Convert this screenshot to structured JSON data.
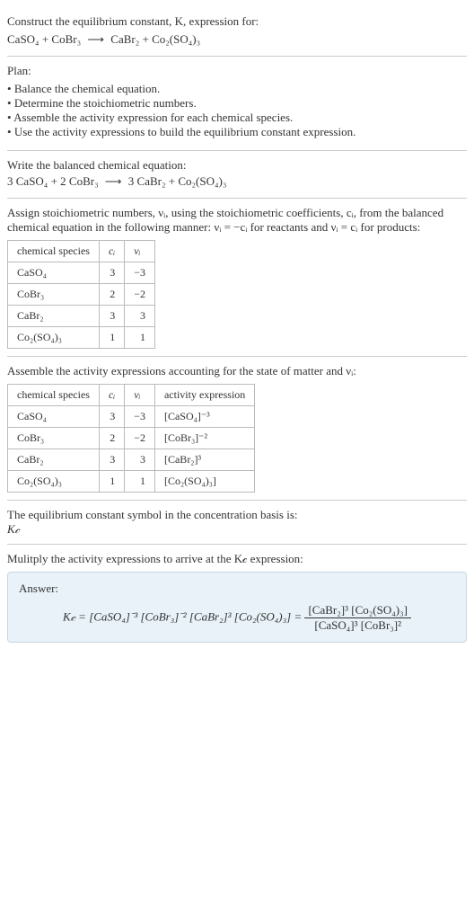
{
  "header": {
    "prompt": "Construct the equilibrium constant, K, expression for:",
    "equation_left": "CaSO₄ + CoBr₃",
    "equation_arrow": "⟶",
    "equation_right": "CaBr₂ + Co₂(SO₄)₃"
  },
  "plan": {
    "title": "Plan:",
    "items": [
      "Balance the chemical equation.",
      "Determine the stoichiometric numbers.",
      "Assemble the activity expression for each chemical species.",
      "Use the activity expressions to build the equilibrium constant expression."
    ]
  },
  "balanced": {
    "title": "Write the balanced chemical equation:",
    "equation_left": "3 CaSO₄ + 2 CoBr₃",
    "equation_arrow": "⟶",
    "equation_right": "3 CaBr₂ + Co₂(SO₄)₃"
  },
  "stoich": {
    "intro1": "Assign stoichiometric numbers, νᵢ, using the stoichiometric coefficients, cᵢ, from the balanced chemical equation in the following manner: νᵢ = −cᵢ for reactants and νᵢ = cᵢ for products:",
    "headers": [
      "chemical species",
      "cᵢ",
      "νᵢ"
    ],
    "rows": [
      {
        "species": "CaSO₄",
        "c": "3",
        "v": "−3"
      },
      {
        "species": "CoBr₃",
        "c": "2",
        "v": "−2"
      },
      {
        "species": "CaBr₂",
        "c": "3",
        "v": "3"
      },
      {
        "species": "Co₂(SO₄)₃",
        "c": "1",
        "v": "1"
      }
    ]
  },
  "activity": {
    "intro": "Assemble the activity expressions accounting for the state of matter and νᵢ:",
    "headers": [
      "chemical species",
      "cᵢ",
      "νᵢ",
      "activity expression"
    ],
    "rows": [
      {
        "species": "CaSO₄",
        "c": "3",
        "v": "−3",
        "expr": "[CaSO₄]⁻³"
      },
      {
        "species": "CoBr₃",
        "c": "2",
        "v": "−2",
        "expr": "[CoBr₃]⁻²"
      },
      {
        "species": "CaBr₂",
        "c": "3",
        "v": "3",
        "expr": "[CaBr₂]³"
      },
      {
        "species": "Co₂(SO₄)₃",
        "c": "1",
        "v": "1",
        "expr": "[Co₂(SO₄)₃]"
      }
    ]
  },
  "symbol": {
    "intro": "The equilibrium constant symbol in the concentration basis is:",
    "value": "K𝒸"
  },
  "multiply": {
    "intro": "Mulitply the activity expressions to arrive at the K𝒸 expression:"
  },
  "answer": {
    "label": "Answer:",
    "lhs": "K𝒸 = [CaSO₄]⁻³ [CoBr₃]⁻² [CaBr₂]³ [Co₂(SO₄)₃] =",
    "frac_num": "[CaBr₂]³ [Co₂(SO₄)₃]",
    "frac_den": "[CaSO₄]³ [CoBr₃]²"
  }
}
